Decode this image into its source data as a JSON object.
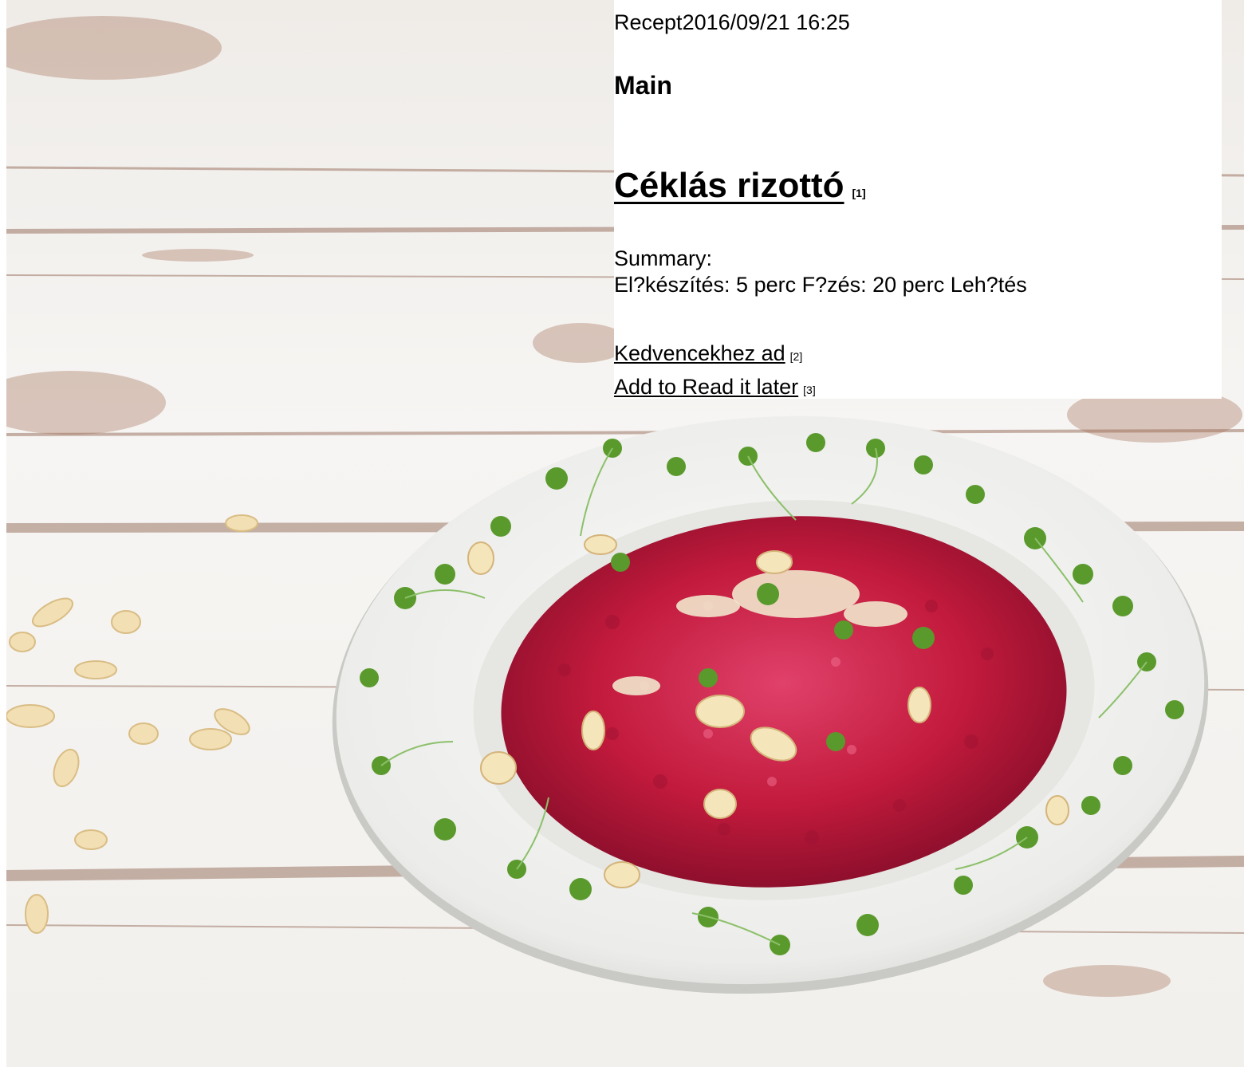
{
  "post": {
    "category": "Recept",
    "timestamp": "2016/09/21 16:25",
    "section": "Main",
    "title": "Céklás rizottó",
    "title_ref": "[1]",
    "summary_label": "Summary:",
    "summary_text": "El?készítés: 5 perc F?zés: 20 perc Leh?tés"
  },
  "actions": {
    "favorite_label": "Kedvencekhez ad",
    "favorite_ref": "[2]",
    "read_later_label": "Add to Read it later",
    "read_later_ref": "[3]"
  },
  "image": {
    "subject": "beetroot risotto plate on white wooden table"
  },
  "colors": {
    "risotto": "#c21a3c",
    "plate": "#f4f4f2",
    "sprouts": "#5a9a2c",
    "wood": "#f3f1ee"
  }
}
